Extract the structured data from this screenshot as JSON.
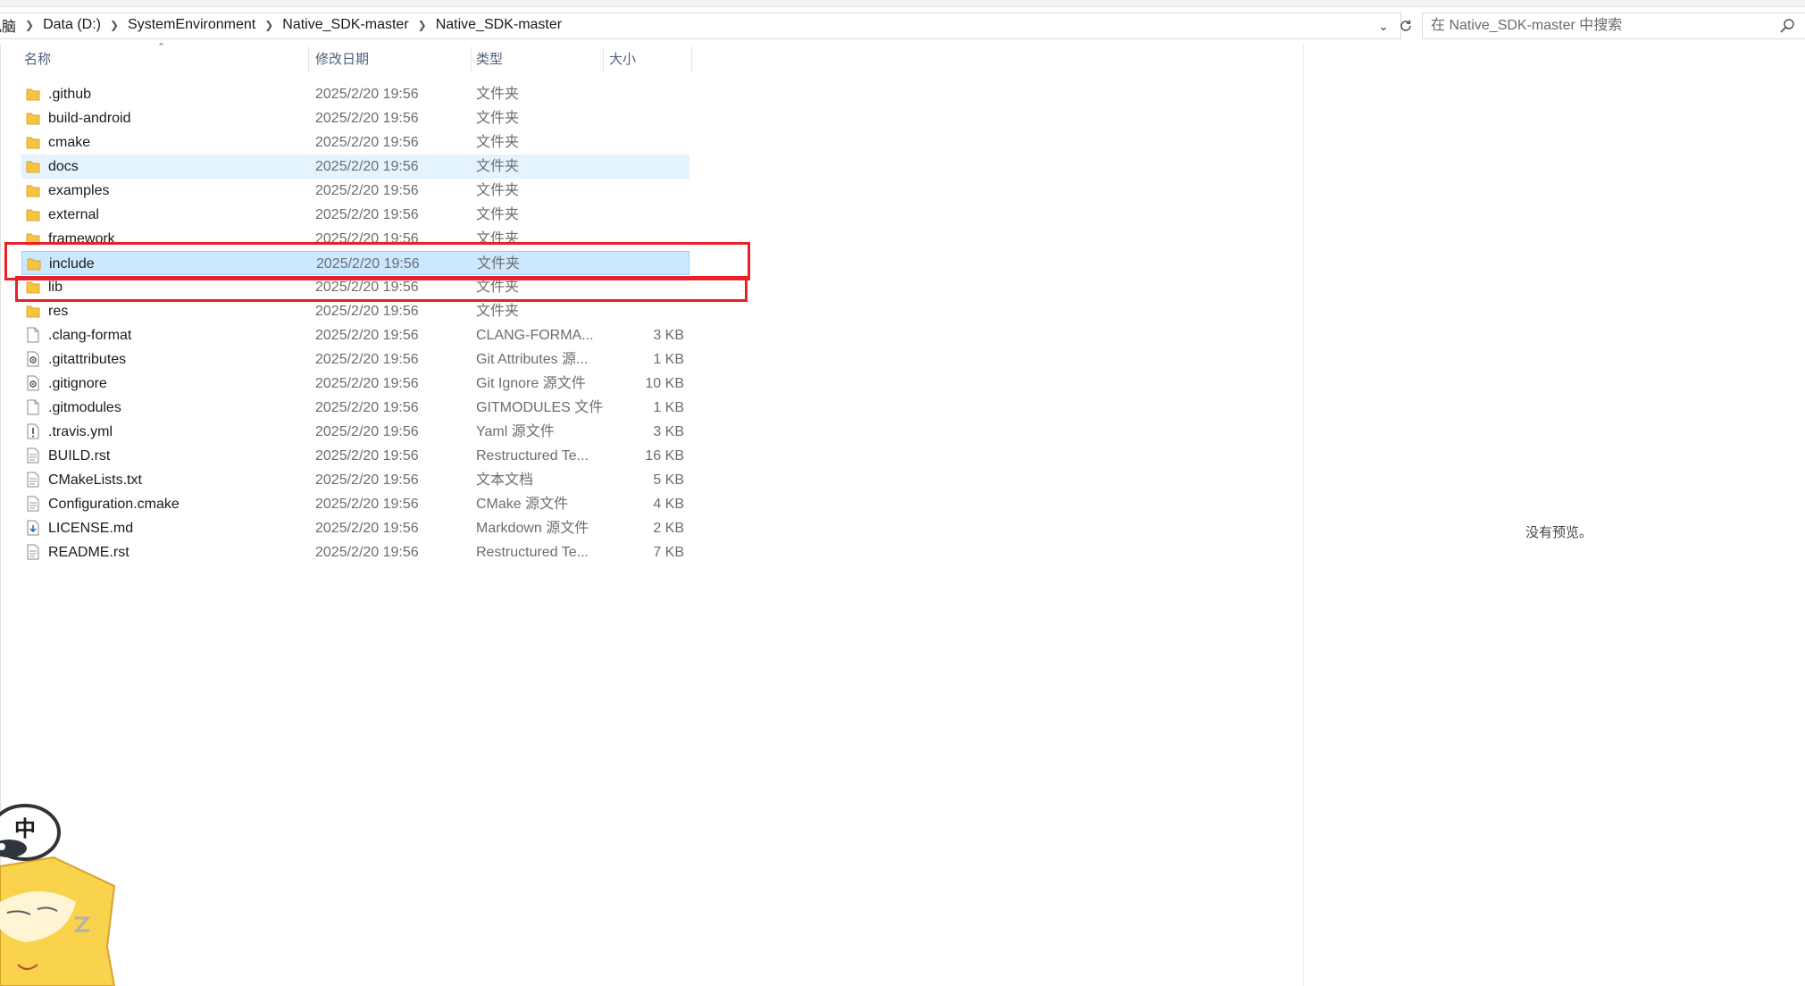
{
  "breadcrumb": [
    "电脑",
    "Data (D:)",
    "SystemEnvironment",
    "Native_SDK-master",
    "Native_SDK-master"
  ],
  "search": {
    "placeholder": "在 Native_SDK-master 中搜索"
  },
  "columns": {
    "name": "名称",
    "date": "修改日期",
    "type": "类型",
    "size": "大小"
  },
  "files": [
    {
      "name": ".github",
      "date": "2025/2/20 19:56",
      "type": "文件夹",
      "size": "",
      "icon": "folder-icon"
    },
    {
      "name": "build-android",
      "date": "2025/2/20 19:56",
      "type": "文件夹",
      "size": "",
      "icon": "folder-icon"
    },
    {
      "name": "cmake",
      "date": "2025/2/20 19:56",
      "type": "文件夹",
      "size": "",
      "icon": "folder-icon"
    },
    {
      "name": "docs",
      "date": "2025/2/20 19:56",
      "type": "文件夹",
      "size": "",
      "icon": "folder-icon"
    },
    {
      "name": "examples",
      "date": "2025/2/20 19:56",
      "type": "文件夹",
      "size": "",
      "icon": "folder-icon"
    },
    {
      "name": "external",
      "date": "2025/2/20 19:56",
      "type": "文件夹",
      "size": "",
      "icon": "folder-icon"
    },
    {
      "name": "framework",
      "date": "2025/2/20 19:56",
      "type": "文件夹",
      "size": "",
      "icon": "folder-icon"
    },
    {
      "name": "include",
      "date": "2025/2/20 19:56",
      "type": "文件夹",
      "size": "",
      "icon": "folder-icon"
    },
    {
      "name": "lib",
      "date": "2025/2/20 19:56",
      "type": "文件夹",
      "size": "",
      "icon": "folder-icon"
    },
    {
      "name": "res",
      "date": "2025/2/20 19:56",
      "type": "文件夹",
      "size": "",
      "icon": "folder-icon"
    },
    {
      "name": ".clang-format",
      "date": "2025/2/20 19:56",
      "type": "CLANG-FORMA...",
      "size": "3 KB",
      "icon": "file-icon"
    },
    {
      "name": ".gitattributes",
      "date": "2025/2/20 19:56",
      "type": "Git Attributes 源...",
      "size": "1 KB",
      "icon": "gear-file-icon"
    },
    {
      "name": ".gitignore",
      "date": "2025/2/20 19:56",
      "type": "Git Ignore 源文件",
      "size": "10 KB",
      "icon": "gear-file-icon"
    },
    {
      "name": ".gitmodules",
      "date": "2025/2/20 19:56",
      "type": "GITMODULES 文件",
      "size": "1 KB",
      "icon": "file-icon"
    },
    {
      "name": ".travis.yml",
      "date": "2025/2/20 19:56",
      "type": "Yaml 源文件",
      "size": "3 KB",
      "icon": "warning-file-icon"
    },
    {
      "name": "BUILD.rst",
      "date": "2025/2/20 19:56",
      "type": "Restructured Te...",
      "size": "16 KB",
      "icon": "text-file-icon"
    },
    {
      "name": "CMakeLists.txt",
      "date": "2025/2/20 19:56",
      "type": "文本文档",
      "size": "5 KB",
      "icon": "text-file-icon"
    },
    {
      "name": "Configuration.cmake",
      "date": "2025/2/20 19:56",
      "type": "CMake 源文件",
      "size": "4 KB",
      "icon": "text-file-icon"
    },
    {
      "name": "LICENSE.md",
      "date": "2025/2/20 19:56",
      "type": "Markdown 源文件",
      "size": "2 KB",
      "icon": "markdown-file-icon"
    },
    {
      "name": "README.rst",
      "date": "2025/2/20 19:56",
      "type": "Restructured Te...",
      "size": "7 KB",
      "icon": "text-file-icon"
    }
  ],
  "state": {
    "hover_row": "docs",
    "selected_row": "include"
  },
  "preview": {
    "text": "没有预览。"
  },
  "ime": {
    "mode": "中"
  },
  "colors": {
    "selected": "#cce8ff",
    "hover": "#e5f3ff",
    "highlight": "#e8202a",
    "folder": "#f6c342"
  }
}
